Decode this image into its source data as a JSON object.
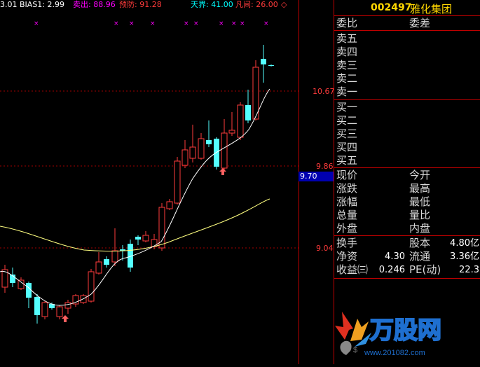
{
  "indicators": [
    {
      "text": "3.01",
      "color": "#ffffff"
    },
    {
      "text": "BIAS1: 2.99",
      "color": "#ffffff"
    },
    {
      "text": "卖出: 88.96",
      "color": "#ff00ff"
    },
    {
      "text": "预防: 91.28",
      "color": "#ff3b3b"
    },
    {
      "text": "天界: 41.00",
      "color": "#00ffff"
    },
    {
      "text": "凡间: 26.00",
      "color": "#ff3b3b"
    },
    {
      "text": "◇",
      "color": "#ff3b3b"
    }
  ],
  "price_axis": {
    "upper": "10.67",
    "mid": "9.86",
    "lower": "9.04"
  },
  "current_price_tag": "9.70",
  "stock": {
    "code": "002497",
    "name": "雅化集团"
  },
  "order_book": {
    "header_left": "委比",
    "header_right": "委差",
    "sell_levels": [
      "卖五",
      "卖四",
      "卖三",
      "卖二",
      "卖一"
    ],
    "buy_levels": [
      "买一",
      "买二",
      "买三",
      "买四",
      "买五"
    ]
  },
  "quote": {
    "rows": [
      {
        "left": "现价",
        "right": "今开"
      },
      {
        "left": "涨跌",
        "right": "最高"
      },
      {
        "left": "涨幅",
        "right": "最低"
      },
      {
        "left": "总量",
        "right": "量比"
      },
      {
        "left": "外盘",
        "right": "内盘"
      }
    ]
  },
  "stats": [
    {
      "left": "换手",
      "left_value": "",
      "right": "股本",
      "right_value": "4.80亿"
    },
    {
      "left": "净资",
      "left_value": "4.30",
      "right": "流通",
      "right_value": "3.36亿"
    },
    {
      "left": "收益㈢",
      "left_value": "0.246",
      "right": "PE(动)",
      "right_value": "22.3"
    }
  ],
  "watermark": {
    "text": "万股网",
    "url": "www.201082.com"
  },
  "colors": {
    "up": "#ff3b3b",
    "down": "#54ffff",
    "ma5": "#ffffff",
    "ma60": "#ffff80",
    "border": "#c00000"
  }
}
